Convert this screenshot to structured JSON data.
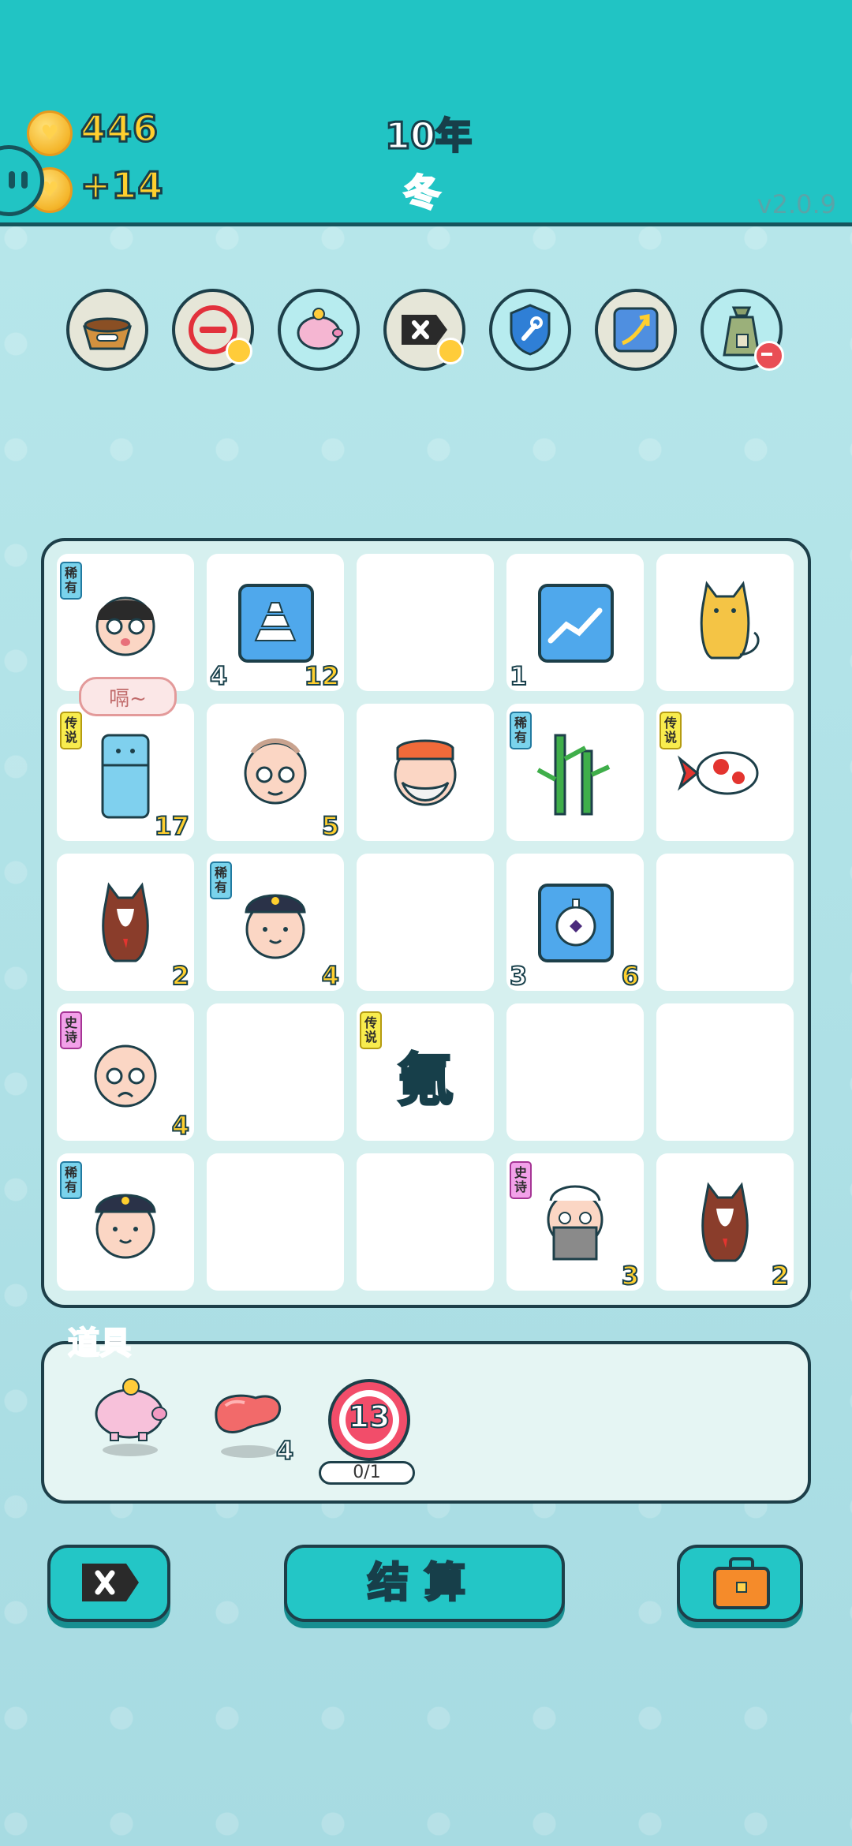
{
  "header": {
    "coins": "446",
    "income": "+14",
    "year": "10年",
    "season": "冬",
    "version": "v2.0.9"
  },
  "tools": [
    {
      "icon": "pet-food-bowl-icon"
    },
    {
      "icon": "remove-circle-icon"
    },
    {
      "icon": "piggy-bank-icon"
    },
    {
      "icon": "delete-tag-icon"
    },
    {
      "icon": "shield-wrench-icon"
    },
    {
      "icon": "upgrade-arrow-icon"
    },
    {
      "icon": "money-bag-icon"
    }
  ],
  "board": {
    "speech": "嗝~",
    "tags": {
      "rare": "稀有",
      "legend": "传说",
      "epic": "史诗"
    },
    "cells": [
      {
        "id": "r1c1",
        "item": "boy-with-glasses",
        "tag": "rare"
      },
      {
        "id": "r1c2",
        "item": "gold-bars",
        "left": "4",
        "right": "12"
      },
      {
        "id": "r1c3",
        "item": "empty"
      },
      {
        "id": "r1c4",
        "item": "chart-card",
        "left": "1"
      },
      {
        "id": "r1c5",
        "item": "cat"
      },
      {
        "id": "r2c1",
        "item": "refrigerator",
        "tag": "legend",
        "right": "17"
      },
      {
        "id": "r2c2",
        "item": "grandpa",
        "right": "5"
      },
      {
        "id": "r2c3",
        "item": "mustache-man"
      },
      {
        "id": "r2c4",
        "item": "bamboo",
        "tag": "rare"
      },
      {
        "id": "r2c5",
        "item": "koi-fish",
        "tag": "legend"
      },
      {
        "id": "r3c1",
        "item": "husky-dog",
        "right": "2"
      },
      {
        "id": "r3c2",
        "item": "police-officer",
        "tag": "rare",
        "right": "4"
      },
      {
        "id": "r3c3",
        "item": "empty"
      },
      {
        "id": "r3c4",
        "item": "stopwatch-card",
        "left": "3",
        "right": "6"
      },
      {
        "id": "r3c5",
        "item": "empty"
      },
      {
        "id": "r4c1",
        "item": "bald-grandpa",
        "tag": "epic",
        "right": "4"
      },
      {
        "id": "r4c2",
        "item": "empty"
      },
      {
        "id": "r4c3",
        "item": "krypton-character",
        "tag": "legend",
        "glyph": "氪"
      },
      {
        "id": "r4c4",
        "item": "empty"
      },
      {
        "id": "r4c5",
        "item": "empty"
      },
      {
        "id": "r5c1",
        "item": "police-officer",
        "tag": "rare"
      },
      {
        "id": "r5c2",
        "item": "empty"
      },
      {
        "id": "r5c3",
        "item": "empty"
      },
      {
        "id": "r5c4",
        "item": "bearded-grandpa",
        "tag": "epic",
        "right": "3"
      },
      {
        "id": "r5c5",
        "item": "husky-dog",
        "right": "2"
      }
    ]
  },
  "items": {
    "label": "道具",
    "list": [
      {
        "icon": "piggy-bank-icon"
      },
      {
        "icon": "liver-icon",
        "count": "4"
      },
      {
        "icon": "target-13-icon",
        "value": "13",
        "progress": "0/1"
      }
    ]
  },
  "buttons": {
    "delete_icon": "delete-tag-icon",
    "settle": "结算",
    "bag_icon": "briefcase-icon"
  },
  "colors": {
    "header": "#21c4c4",
    "board_border": "#1d3f49",
    "gold": "#ffcf2e",
    "pink": "#ff5e7c"
  }
}
